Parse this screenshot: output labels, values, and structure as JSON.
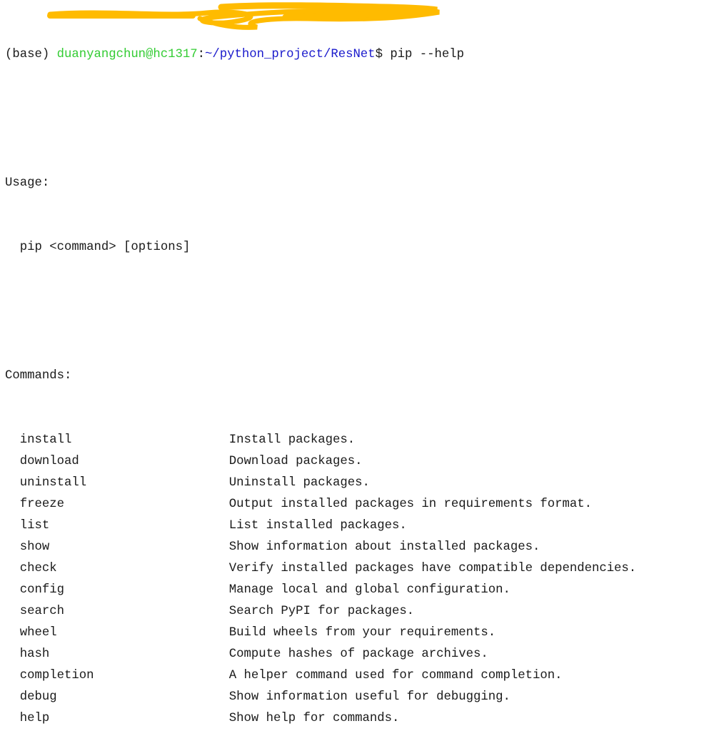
{
  "prompt": {
    "env": "(base)",
    "user_host": "duanyangchun@hc1317",
    "separator": ":",
    "path": "~/python_project/ResNet",
    "symbol": "$",
    "command": "pip --help"
  },
  "usage": {
    "heading": "Usage:",
    "syntax": "pip <command> [options]"
  },
  "commands": {
    "heading": "Commands:",
    "items": [
      {
        "name": "install",
        "desc": "Install packages."
      },
      {
        "name": "download",
        "desc": "Download packages."
      },
      {
        "name": "uninstall",
        "desc": "Uninstall packages."
      },
      {
        "name": "freeze",
        "desc": "Output installed packages in requirements format."
      },
      {
        "name": "list",
        "desc": "List installed packages."
      },
      {
        "name": "show",
        "desc": "Show information about installed packages."
      },
      {
        "name": "check",
        "desc": "Verify installed packages have compatible dependencies."
      },
      {
        "name": "config",
        "desc": "Manage local and global configuration."
      },
      {
        "name": "search",
        "desc": "Search PyPI for packages."
      },
      {
        "name": "wheel",
        "desc": "Build wheels from your requirements."
      },
      {
        "name": "hash",
        "desc": "Compute hashes of package archives."
      },
      {
        "name": "completion",
        "desc": "A helper command used for command completion."
      },
      {
        "name": "debug",
        "desc": "Show information useful for debugging."
      },
      {
        "name": "help",
        "desc": "Show help for commands."
      }
    ]
  },
  "colors": {
    "user": "#33cc33",
    "path": "#1a1acc",
    "redaction": "#ffbb00"
  }
}
